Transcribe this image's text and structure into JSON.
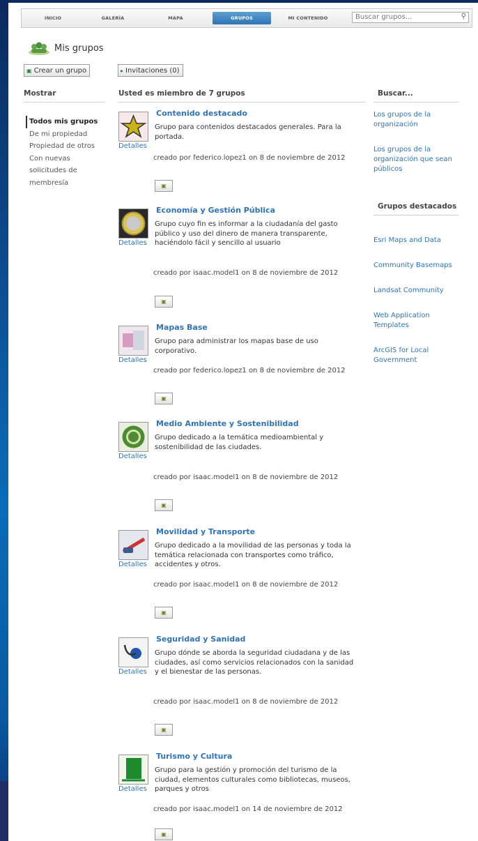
{
  "nav": {
    "tabs": [
      {
        "label": "INICIO",
        "active": false
      },
      {
        "label": "GALERÍA",
        "active": false
      },
      {
        "label": "MAPA",
        "active": false
      },
      {
        "label": "GRUPOS",
        "active": true
      },
      {
        "label": "MI CONTENIDO",
        "active": false
      }
    ],
    "search_placeholder": "Buscar grupos..."
  },
  "page": {
    "title": "Mis grupos",
    "create_button": "Crear un grupo",
    "invitations_button": "Invitaciones (0)"
  },
  "columns": {
    "show_head": "Mostrar",
    "member_head": "Usted es miembro de 7 grupos",
    "search_head": "Buscar..."
  },
  "filters": [
    {
      "label": "Todos mis grupos",
      "selected": true
    },
    {
      "label": "De mi propiedad",
      "selected": false
    },
    {
      "label": "Propiedad de otros",
      "selected": false
    },
    {
      "label": "Con nuevas solicitudes de membresía",
      "selected": false
    }
  ],
  "groups": [
    {
      "title": "Contenido destacado",
      "description": "Grupo para contenidos destacados generales. Para la portada.",
      "meta": "creado por federico.lopez1 on 8 de noviembre de 2012",
      "detail_label": "Detalles",
      "icon": "star-icon"
    },
    {
      "title": "Economía y Gestión Pública",
      "description": "Grupo cuyo fin es informar a la ciudadanía del gasto público y uso del dinero de manera transparente, haciéndolo fácil y sencillo al usuario",
      "meta": "creado por isaac.model1 on 8 de noviembre de 2012",
      "detail_label": "Detalles",
      "icon": "coin-icon"
    },
    {
      "title": "Mapas Base",
      "description": "Grupo para administrar los mapas base de uso corporativo.",
      "meta": "creado por federico.lopez1 on 8 de noviembre de 2012",
      "detail_label": "Detalles",
      "icon": "basemap-icon"
    },
    {
      "title": "Medio Ambiente y Sostenibilidad",
      "description": "Grupo dedicado a la temática medioambiental y sostenibilidad de las ciudades.",
      "meta": "creado por isaac.model1 on 8 de noviembre de 2012",
      "detail_label": "Detalles",
      "icon": "recycle-icon"
    },
    {
      "title": "Movilidad y Transporte",
      "description": "Grupo dedicado a la movilidad de las personas y toda la temática relacionada con transportes como tráfico, accidentes y otros.",
      "meta": "creado por isaac.model1 on 8 de noviembre de 2012",
      "detail_label": "Detalles",
      "icon": "transport-icon"
    },
    {
      "title": "Seguridad y Sanidad",
      "description": "Grupo dónde se aborda la seguridad ciudadana y de las ciudades, así como servicios relacionados con la sanidad y el bienestar de las personas.",
      "meta": "creado por isaac.model1 on 8 de noviembre de 2012",
      "detail_label": "Detalles",
      "icon": "stethoscope-icon"
    },
    {
      "title": "Turismo y Cultura",
      "description": "Grupo para la gestión y promoción del turismo de la ciudad, elementos culturales como bibliotecas, museos, parques y otros",
      "meta": "creado por isaac.model1 on 14 de noviembre de 2012",
      "detail_label": "Detalles",
      "icon": "tourism-icon"
    }
  ],
  "search_links": [
    "Los grupos de la organización",
    "Los grupos de la organización que sean públicos"
  ],
  "featured_head": "Grupos destacados",
  "featured_groups": [
    "Esri Maps and Data",
    "Community Basemaps",
    "Landsat Community",
    "Web Application Templates",
    "ArcGIS for Local Government"
  ]
}
